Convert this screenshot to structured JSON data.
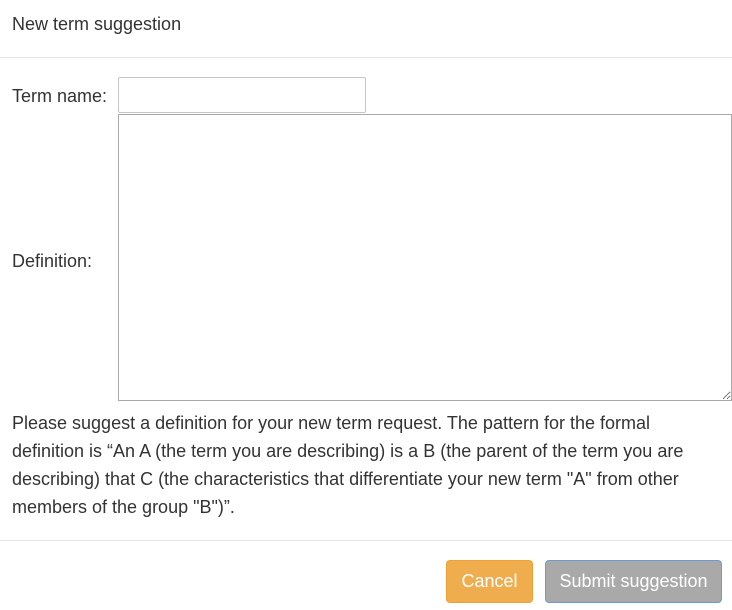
{
  "dialog": {
    "title": "New term suggestion"
  },
  "form": {
    "term_name_label": "Term name:",
    "term_name_value": "",
    "definition_label": "Definition:",
    "definition_value": "",
    "help_text": "Please suggest a definition for your new term request. The pattern for the formal definition is “An A (the term you are describing) is a B (the parent of the term you are describing) that C (the characteristics that differentiate your new term \"A\" from other members of the group \"B\")”."
  },
  "footer": {
    "cancel_label": "Cancel",
    "submit_label": "Submit suggestion"
  },
  "colors": {
    "cancel_button": "#f0ad4e",
    "submit_button_disabled": "#a9a9a9"
  }
}
